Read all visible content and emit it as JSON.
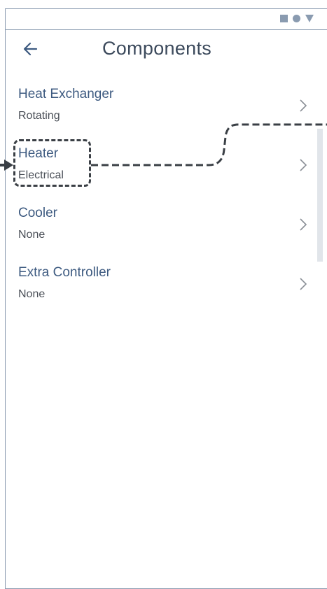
{
  "header": {
    "title": "Components"
  },
  "items": [
    {
      "title": "Heat Exchanger",
      "subtitle": "Rotating"
    },
    {
      "title": "Heater",
      "subtitle": "Electrical"
    },
    {
      "title": "Cooler",
      "subtitle": "None"
    },
    {
      "title": "Extra Controller",
      "subtitle": "None"
    }
  ],
  "icons": {
    "status": [
      "square-icon",
      "circle-icon",
      "triangle-icon"
    ],
    "back": "arrow-left-icon",
    "chevron": "chevron-right-icon"
  },
  "colors": {
    "title": "#3c4a5c",
    "item_title": "#3d5a80",
    "subtitle": "#4a4f57",
    "frame": "#8a9bb0",
    "annotation": "#3a3f45"
  }
}
